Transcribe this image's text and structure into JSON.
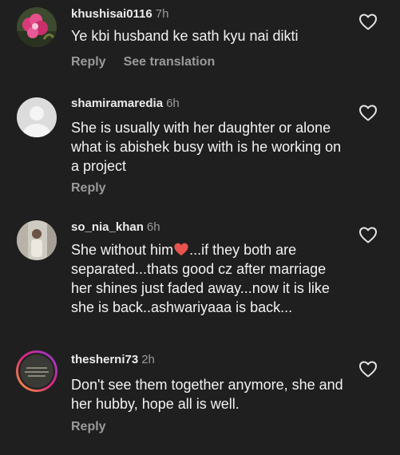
{
  "comments": [
    {
      "username": "khushisai0116",
      "time": "7h",
      "text": "Ye kbi husband ke sath kyu nai dikti",
      "reply_label": "Reply",
      "see_translation_label": "See translation",
      "avatar": "pink-flower-photo"
    },
    {
      "username": "shamiramaredia",
      "time": "6h",
      "text": "She is usually with her daughter or alone what is abishek busy with is he working on a project",
      "reply_label": "Reply",
      "avatar": "default-gray-avatar"
    },
    {
      "username": "so_nia_khan",
      "time": "6h",
      "text_before_emoji": "She without him",
      "emoji": "red-heart",
      "text_after_emoji": "...if they both are separated...thats good cz after marriage her shines just faded away...now it is like she is back..ashwariyaaa is back...",
      "avatar": "person-photo"
    },
    {
      "username": "thesherni73",
      "time": "2h",
      "text": "Don't see them together anymore, she and her hubby, hope all is well.",
      "reply_label": "Reply",
      "avatar": "story-ring-dark-photo"
    }
  ],
  "icons": {
    "like": "heart-outline-icon"
  },
  "colors": {
    "background": "#1f1f1f",
    "text": "#f2f2f2",
    "muted": "#9a9a9a",
    "heart": "#e8534f"
  }
}
